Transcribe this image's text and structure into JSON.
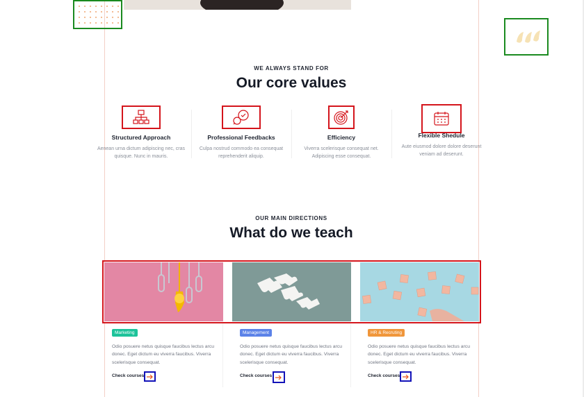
{
  "colors": {
    "accent_red": "#d4141b",
    "marketing": "#1cc39a",
    "management": "#5b82e8",
    "hr": "#f0963a",
    "frame": "#f3cfc6"
  },
  "values_section": {
    "eyebrow": "WE ALWAYS STAND FOR",
    "title": "Our core values",
    "items": [
      {
        "icon": "hierarchy-icon",
        "title": "Structured Approach",
        "desc": "Aenean urna dictum adipiscing nec, cras quisque. Nunc in mauris."
      },
      {
        "icon": "chat-bubbles-icon",
        "title": "Professional Feedbacks",
        "desc": "Culpa nostrud commodo ea consequat reprehenderit aliquip."
      },
      {
        "icon": "target-icon",
        "title": "Efficiency",
        "desc": "Viverra scelerisque consequat net. Adipiscing esse consequat."
      },
      {
        "icon": "calendar-icon",
        "title": "Flexible Shedule",
        "desc": "Aute eiusmod dolore dolore deserunt veniam ad deserunt."
      }
    ]
  },
  "teach_section": {
    "eyebrow": "OUR MAIN DIRECTIONS",
    "title": "What do we teach",
    "cards": [
      {
        "image": "lightbulb-clips-image",
        "tag": "Marketing",
        "desc": "Odio posuere netus quisque faucibus lectus arcu donec. Eget dictum eu viverra faucibus. Viverra scelerisque consequat.",
        "cta": "Check courses"
      },
      {
        "image": "puzzle-pieces-image",
        "tag": "Management",
        "desc": "Odio posuere netus quisque faucibus lectus arcu donec. Eget dictum eu viverra faucibus. Viverra scelerisque consequat.",
        "cta": "Check courses"
      },
      {
        "image": "people-cubes-image",
        "tag": "HR & Recruting",
        "desc": "Odio posuere netus quisque faucibus lectus arcu donec. Eget dictum eu viverra faucibus. Viverra scelerisque consequat.",
        "cta": "Check courses"
      }
    ]
  }
}
